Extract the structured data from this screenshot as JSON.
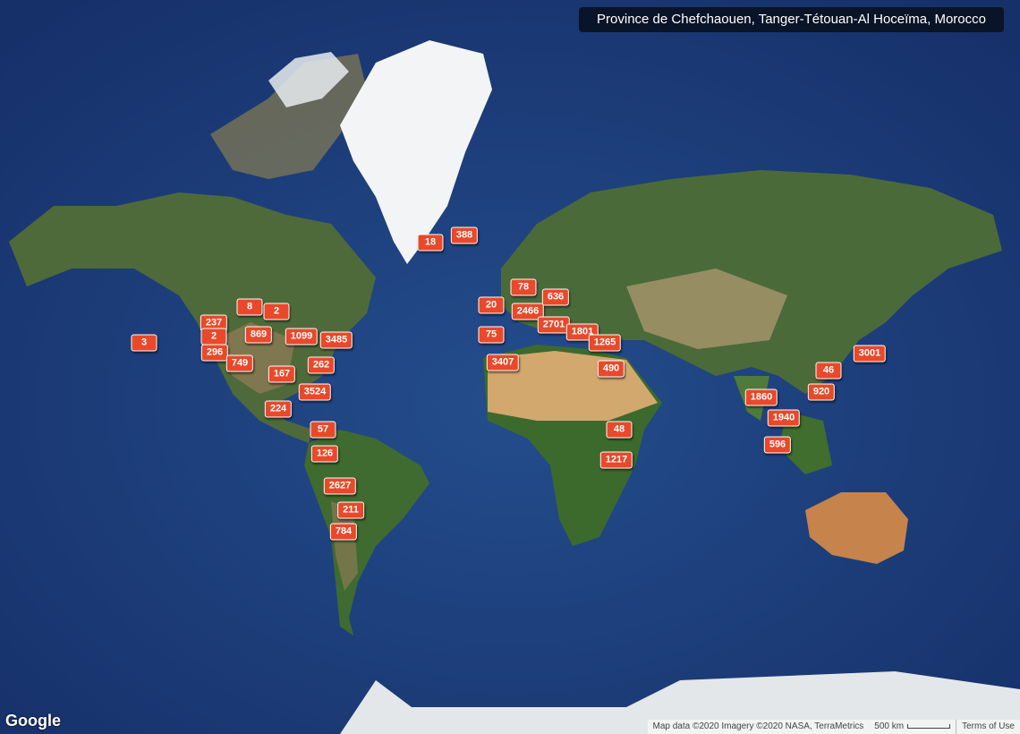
{
  "map": {
    "title": "Province de Chefchaouen, Tanger-Tétouan-Al Hoceïma, Morocco",
    "markers": [
      "18",
      "388",
      "8",
      "2",
      "237",
      "2",
      "296",
      "869",
      "1099",
      "3485",
      "749",
      "167",
      "262",
      "3524",
      "224",
      "57",
      "126",
      "2627",
      "211",
      "784",
      "3",
      "20",
      "78",
      "636",
      "2466",
      "2701",
      "1801",
      "1265",
      "75",
      "3407",
      "490",
      "48",
      "1217",
      "1860",
      "1940",
      "596",
      "46",
      "920",
      "3001"
    ],
    "marker_color": "#e8492a",
    "ocean_color": "#1d3f7a",
    "google_label": "Google",
    "attribution": {
      "map_data": "Map data ©2020 Imagery ©2020 NASA, TerraMetrics",
      "scale": "500 km",
      "terms": "Terms of Use"
    }
  }
}
